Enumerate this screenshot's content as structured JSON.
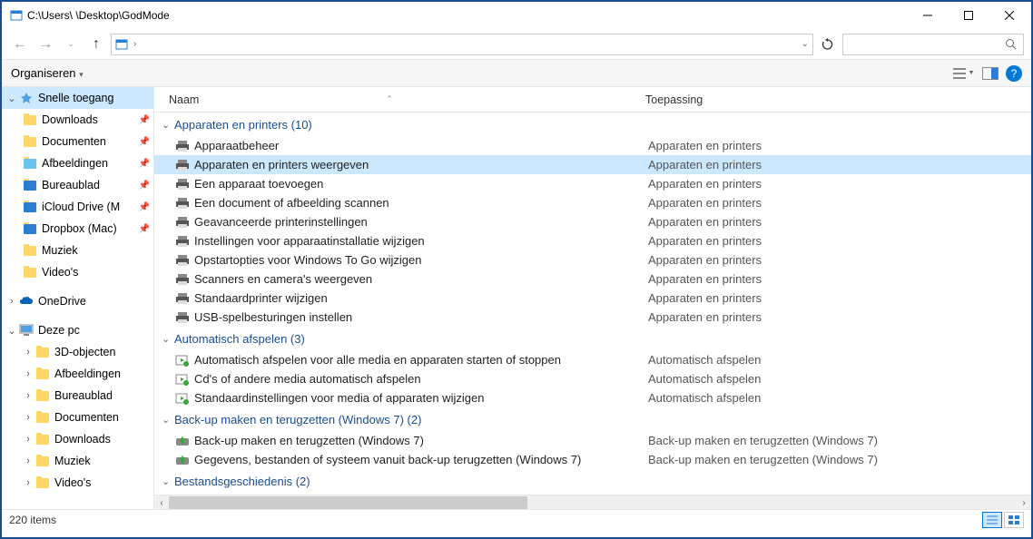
{
  "titlebar": {
    "path": "C:\\Users\\        \\Desktop\\GodMode"
  },
  "toolbar": {
    "organize": "Organiseren"
  },
  "columns": {
    "name": "Naam",
    "application": "Toepassing"
  },
  "sidebar": {
    "quick_access": "Snelle toegang",
    "quick_items": [
      {
        "label": "Downloads",
        "pinned": true,
        "color": "#ffd668"
      },
      {
        "label": "Documenten",
        "pinned": true,
        "color": "#ffd668"
      },
      {
        "label": "Afbeeldingen",
        "pinned": true,
        "color": "#6cc3f0"
      },
      {
        "label": "Bureaublad",
        "pinned": true,
        "color": "#2a7dd4"
      },
      {
        "label": "iCloud Drive (M",
        "pinned": true,
        "color": "#2a7dd4"
      },
      {
        "label": "Dropbox (Mac)",
        "pinned": true,
        "color": "#2a7dd4"
      },
      {
        "label": "Muziek",
        "pinned": false,
        "color": "#ffd668"
      },
      {
        "label": "Video's",
        "pinned": false,
        "color": "#ffd668"
      }
    ],
    "onedrive": "OneDrive",
    "thispc": "Deze pc",
    "pc_items": [
      {
        "label": "3D-objecten"
      },
      {
        "label": "Afbeeldingen"
      },
      {
        "label": "Bureaublad"
      },
      {
        "label": "Documenten"
      },
      {
        "label": "Downloads"
      },
      {
        "label": "Muziek"
      },
      {
        "label": "Video's"
      }
    ]
  },
  "groups": [
    {
      "title": "Apparaten en printers (10)",
      "app": "Apparaten en printers",
      "icon": "printer",
      "items": [
        {
          "name": "Apparaatbeheer",
          "sel": false
        },
        {
          "name": "Apparaten en printers weergeven",
          "sel": true
        },
        {
          "name": "Een apparaat toevoegen",
          "sel": false
        },
        {
          "name": "Een document of afbeelding scannen",
          "sel": false
        },
        {
          "name": "Geavanceerde printerinstellingen",
          "sel": false
        },
        {
          "name": "Instellingen voor apparaatinstallatie wijzigen",
          "sel": false
        },
        {
          "name": "Opstartopties voor Windows To Go wijzigen",
          "sel": false
        },
        {
          "name": "Scanners en camera's weergeven",
          "sel": false
        },
        {
          "name": "Standaardprinter wijzigen",
          "sel": false
        },
        {
          "name": "USB-spelbesturingen instellen",
          "sel": false
        }
      ]
    },
    {
      "title": "Automatisch afspelen (3)",
      "app": "Automatisch afspelen",
      "icon": "autoplay",
      "items": [
        {
          "name": "Automatisch afspelen voor alle media en apparaten starten of stoppen",
          "sel": false
        },
        {
          "name": "Cd's of andere media automatisch afspelen",
          "sel": false
        },
        {
          "name": "Standaardinstellingen voor media of apparaten wijzigen",
          "sel": false
        }
      ]
    },
    {
      "title": "Back-up maken en terugzetten (Windows 7) (2)",
      "app": "Back-up maken en terugzetten (Windows 7)",
      "icon": "backup",
      "items": [
        {
          "name": "Back-up maken en terugzetten (Windows 7)",
          "sel": false
        },
        {
          "name": "Gegevens, bestanden of systeem vanuit back-up terugzetten (Windows 7)",
          "sel": false
        }
      ]
    },
    {
      "title": "Bestandsgeschiedenis (2)",
      "app": "Bestandsgeschiedenis",
      "icon": "history",
      "items": []
    }
  ],
  "status": {
    "count": "220 items"
  }
}
